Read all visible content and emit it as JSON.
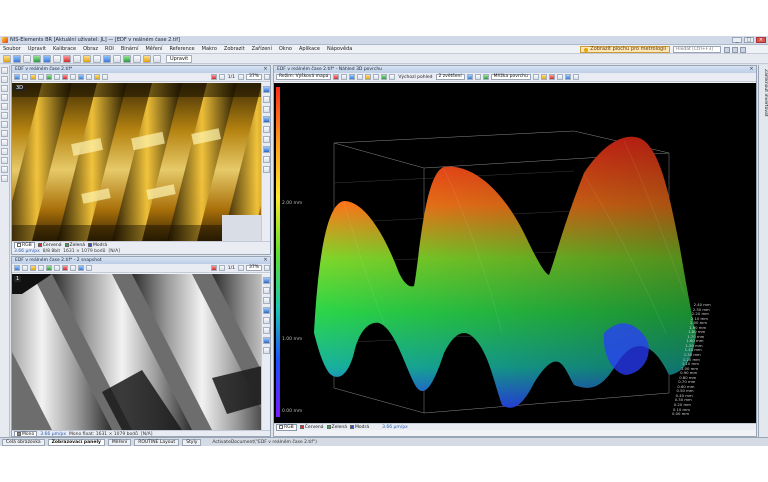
{
  "window": {
    "title": "NIS-Elements BR [Aktuální uživatel: JL] — [EDF v reálném čase 2.tif]",
    "buttons": [
      "_",
      "□",
      "×"
    ]
  },
  "menu": {
    "items": [
      "Soubor",
      "Upravit",
      "Kalibrace",
      "Obraz",
      "ROI",
      "Binární",
      "Měření",
      "Reference",
      "Makro",
      "Zobrazit",
      "Zařízení",
      "Okno",
      "Aplikace",
      "Nápověda"
    ],
    "hint_button": "Zobrazit plochu pro metrologii",
    "help_placeholder": "Hledat [Ctrl+F3]"
  },
  "toolbar": {
    "layout_label": "Upravit"
  },
  "panel_tl": {
    "title": "EDF v reálném čase 2.tif*",
    "page": "1/1",
    "zoom": "37%",
    "badge": "3D",
    "channels": [
      "RGB",
      "Červená",
      "Zelená",
      "Modrá"
    ],
    "channel_colors": [
      "#ffffff",
      "#e02a2a",
      "#2fb34a",
      "#2a4fe0"
    ],
    "status": [
      "3.66 µm/px",
      "8/8 8bit",
      "1631 × 1079 bodů",
      "[N/A]"
    ]
  },
  "panel_bl": {
    "title": "EDF v reálném čase 2.tif* - 2 snapshot",
    "page": "1/1",
    "zoom": "37%",
    "badge": "1",
    "channel": "Mono",
    "status": [
      "3.66 µm/px",
      "Mono float: 1631 × 1079 bodů",
      "[N/A]"
    ]
  },
  "panel_3d": {
    "title": "EDF v reálném čase 2.tif* - Náhled 3D povrchu",
    "mode_label": "Režim: Výšková mapa",
    "view_label": "Výchozí pohled",
    "zoom_label": "2 zvětšení",
    "grid_label": "Mřížka povrchu",
    "channels": [
      "RGB",
      "Červená",
      "Zelená",
      "Modrá"
    ],
    "status": "3.66 µm/px",
    "axis_labels": [
      "2.40 mm",
      "2.30 mm",
      "2.20 mm",
      "2.10 mm",
      "2.00 mm",
      "1.90 mm",
      "1.80 mm",
      "1.70 mm",
      "1.60 mm",
      "1.50 mm",
      "1.40 mm",
      "1.30 mm",
      "1.20 mm",
      "1.10 mm",
      "1.00 mm",
      "0.90 mm",
      "0.80 mm",
      "0.70 mm",
      "0.60 mm",
      "0.50 mm",
      "0.40 mm",
      "0.30 mm",
      "0.20 mm",
      "0.10 mm",
      "0.00 mm"
    ],
    "z_labels": [
      "2.00 mm",
      "1.00 mm",
      "0.00 mm"
    ]
  },
  "dock": {
    "label": "Zamknout invertovat"
  },
  "taskbar": {
    "items": [
      "Celá obrazovka",
      "Zobrazovací panely",
      "Měření",
      "ROUTINE Layout",
      "Styly"
    ],
    "status": "ActivateDocument(\"EDF v reálném čase 2.tif\")"
  }
}
